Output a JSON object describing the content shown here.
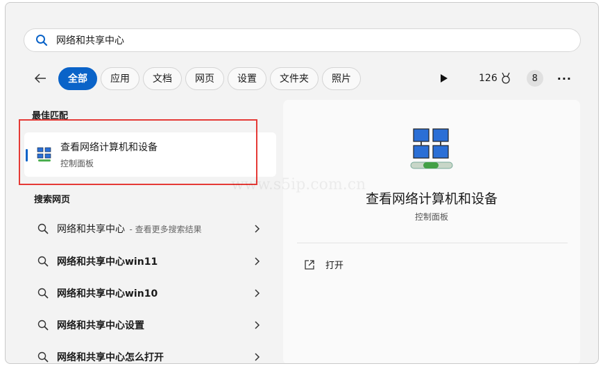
{
  "search": {
    "value": "网络和共享中心"
  },
  "filters": [
    "全部",
    "应用",
    "文档",
    "网页",
    "设置",
    "文件夹",
    "照片"
  ],
  "toolbar": {
    "points": "126",
    "avatar_letter": "8",
    "more": "···"
  },
  "best_match": {
    "heading": "最佳匹配",
    "title": "查看网络计算机和设备",
    "subtitle": "控制面板"
  },
  "web_search": {
    "heading": "搜索网页",
    "items": [
      {
        "label": "网络和共享中心",
        "suffix": "- 查看更多搜索结果"
      },
      {
        "label": "网络和共享中心win11",
        "suffix": ""
      },
      {
        "label": "网络和共享中心win10",
        "suffix": ""
      },
      {
        "label": "网络和共享中心设置",
        "suffix": ""
      },
      {
        "label": "网络和共享中心怎么打开",
        "suffix": ""
      }
    ]
  },
  "detail": {
    "title": "查看网络计算机和设备",
    "subtitle": "控制面板",
    "action_open": "打开"
  },
  "watermark": "www.s5ip.com.cn",
  "colors": {
    "accent": "#0a63c8",
    "highlight": "#e53935"
  }
}
